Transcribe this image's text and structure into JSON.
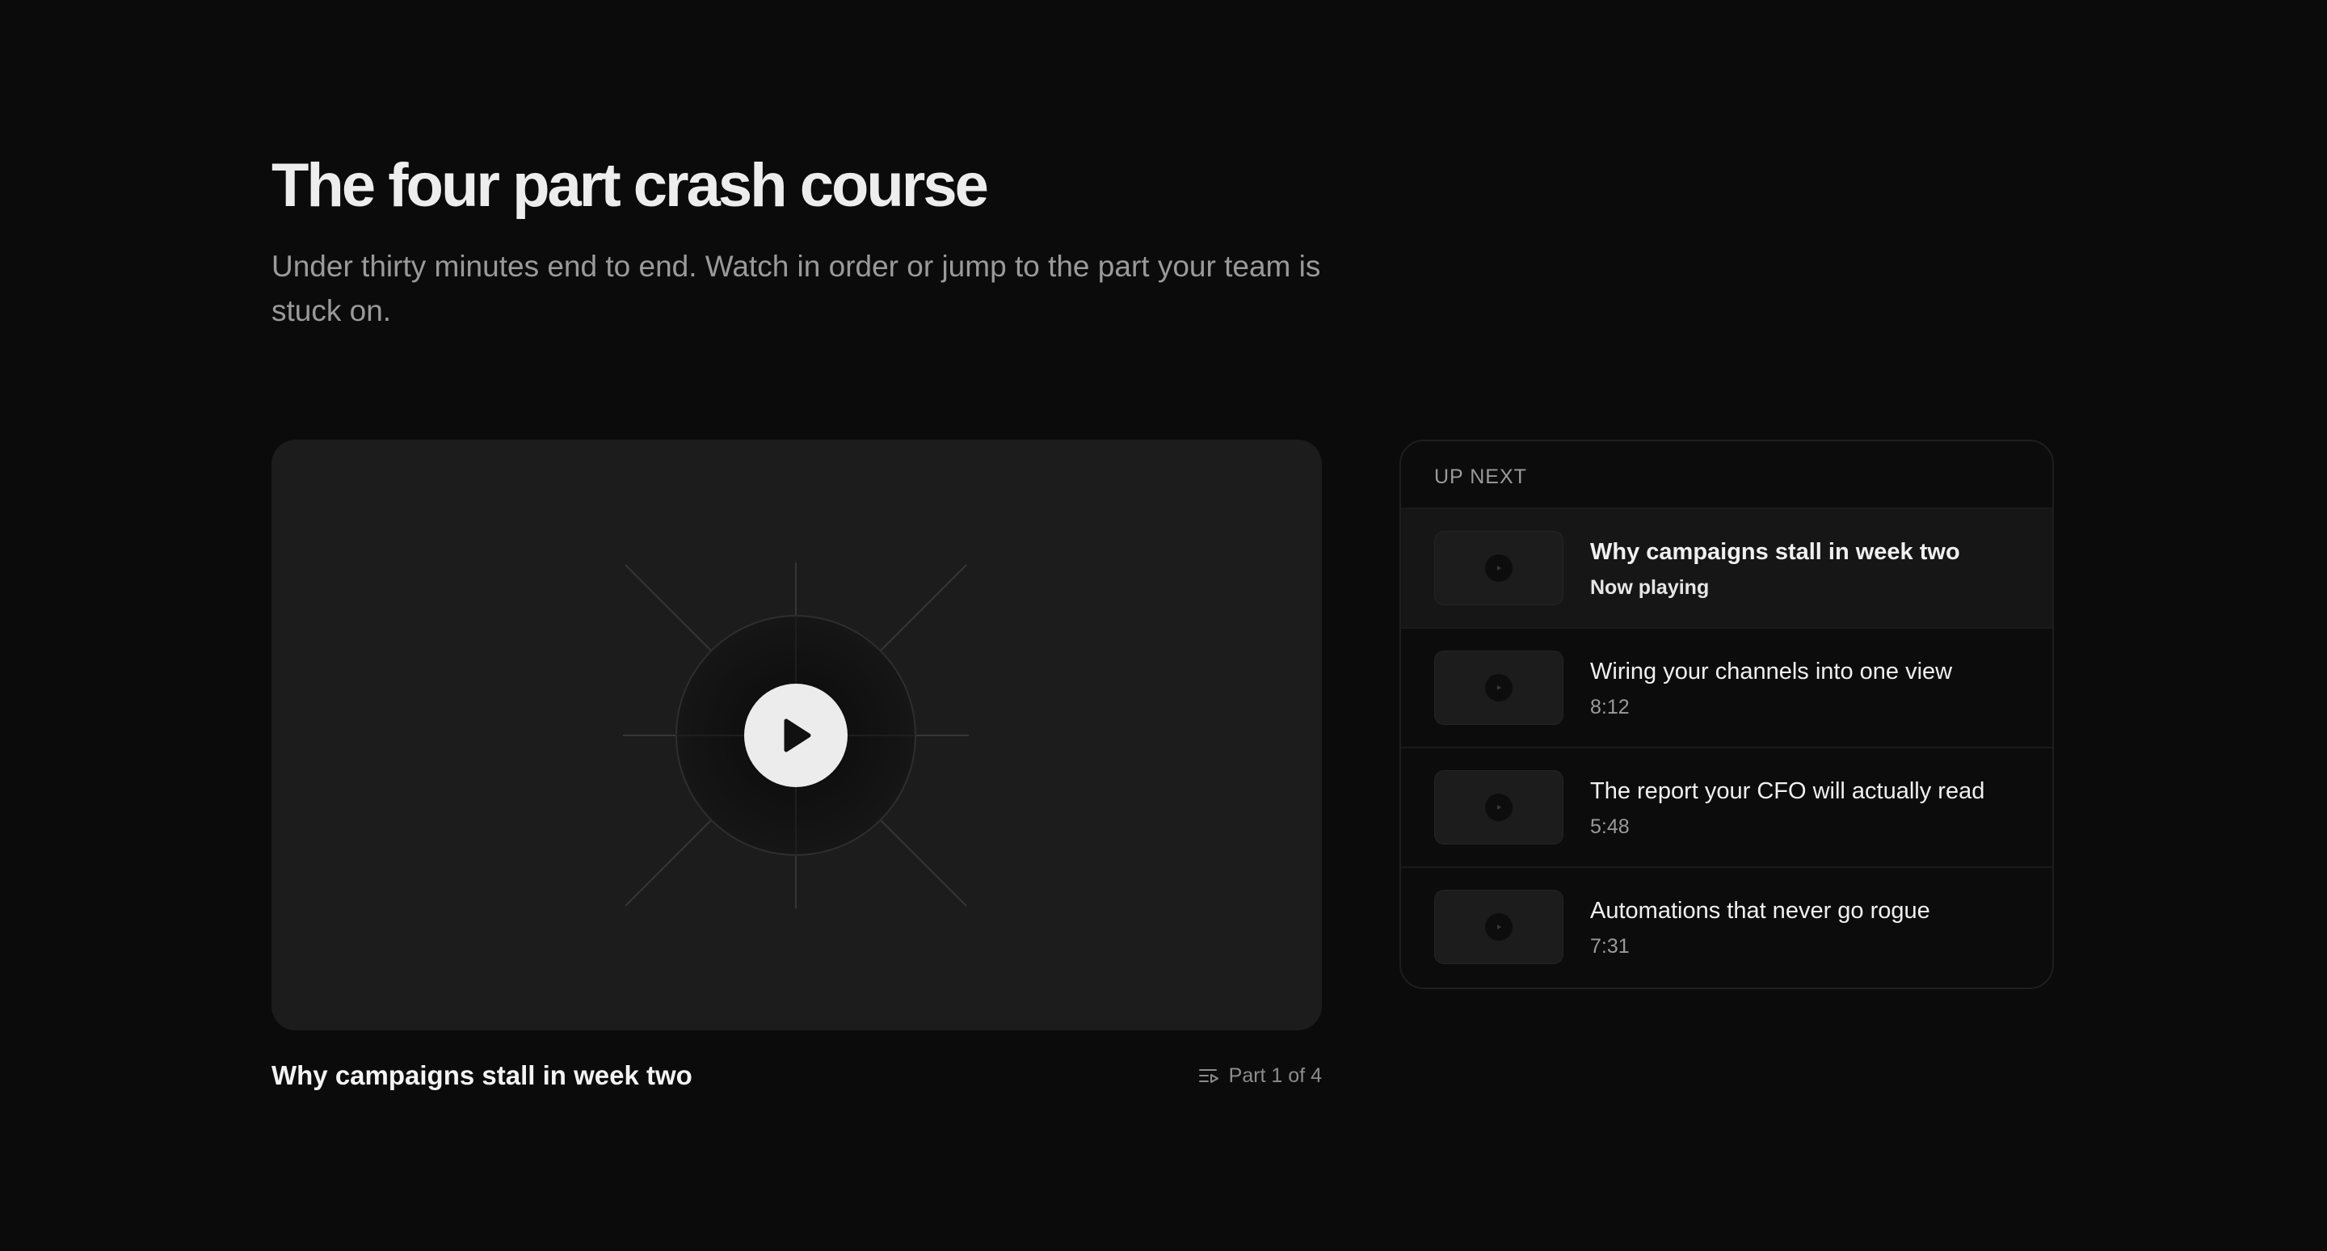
{
  "header": {
    "title": "The four part crash course",
    "subtitle": "Under thirty minutes end to end. Watch in order or jump to the part your team is stuck on."
  },
  "player": {
    "caption": "Why campaigns stall in week two",
    "part_label": "Part 1 of 4",
    "play_icon": "play-icon",
    "part_icon": "playlist-icon"
  },
  "up_next": {
    "heading": "UP NEXT",
    "items": [
      {
        "title": "Why campaigns stall in week two",
        "meta": "Now playing",
        "active": true
      },
      {
        "title": "Wiring your channels into one view",
        "meta": "8:12",
        "active": false
      },
      {
        "title": "The report your CFO will actually read",
        "meta": "5:48",
        "active": false
      },
      {
        "title": "Automations that never go rogue",
        "meta": "7:31",
        "active": false
      }
    ]
  },
  "colors": {
    "background": "#0b0b0b",
    "player_surface": "#1c1c1c",
    "active_row": "#161616",
    "text_primary": "#f2f2f2",
    "text_secondary": "#9a9a9a"
  }
}
